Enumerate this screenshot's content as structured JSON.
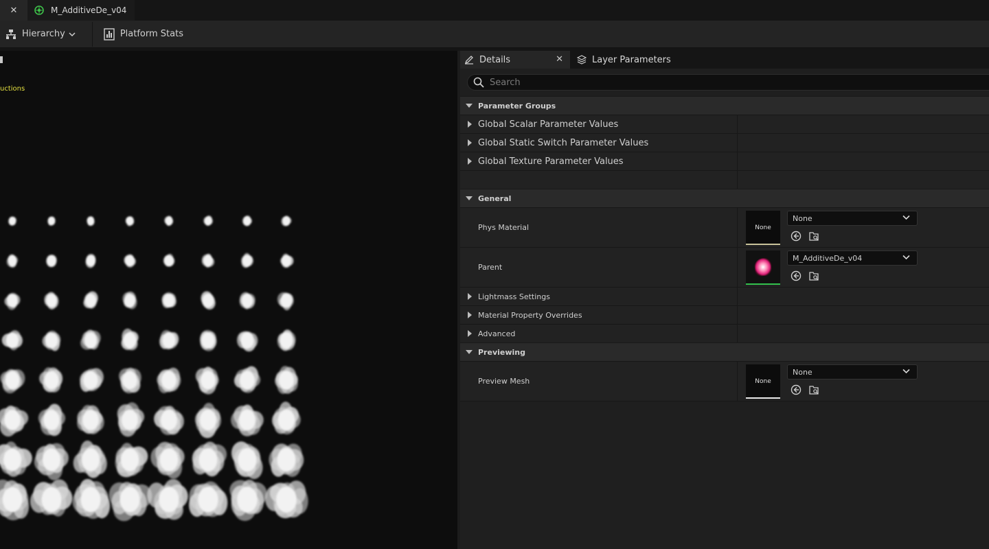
{
  "window": {
    "doc_tab_title": "M_AdditiveDe_v04"
  },
  "toolbar": {
    "hierarchy_label": "Hierarchy",
    "platform_stats_label": "Platform Stats"
  },
  "viewport": {
    "overlay_text": "uctions"
  },
  "details_panel": {
    "tabs": [
      {
        "label": "Details"
      },
      {
        "label": "Layer Parameters"
      }
    ],
    "search": {
      "placeholder": "Search",
      "value": ""
    },
    "categories": {
      "parameter_groups": {
        "label": "Parameter Groups",
        "items": [
          {
            "label": "Global Scalar Parameter Values"
          },
          {
            "label": "Global Static Switch Parameter Values"
          },
          {
            "label": "Global Texture Parameter Values"
          }
        ]
      },
      "general": {
        "label": "General",
        "phys_material": {
          "label": "Phys Material",
          "thumb_text": "None",
          "value": "None"
        },
        "parent": {
          "label": "Parent",
          "value": "M_AdditiveDe_v04"
        },
        "lightmass": {
          "label": "Lightmass Settings"
        },
        "material_overrides": {
          "label": "Material Property Overrides"
        },
        "advanced": {
          "label": "Advanced"
        }
      },
      "previewing": {
        "label": "Previewing",
        "preview_mesh": {
          "label": "Preview Mesh",
          "thumb_text": "None",
          "value": "None"
        }
      }
    }
  },
  "colors": {
    "phys_material_bar": "#c9c39a",
    "parent_bar": "#33c24d",
    "preview_mesh_bar": "#e8e8e8",
    "overlay_text": "#e4e040"
  }
}
